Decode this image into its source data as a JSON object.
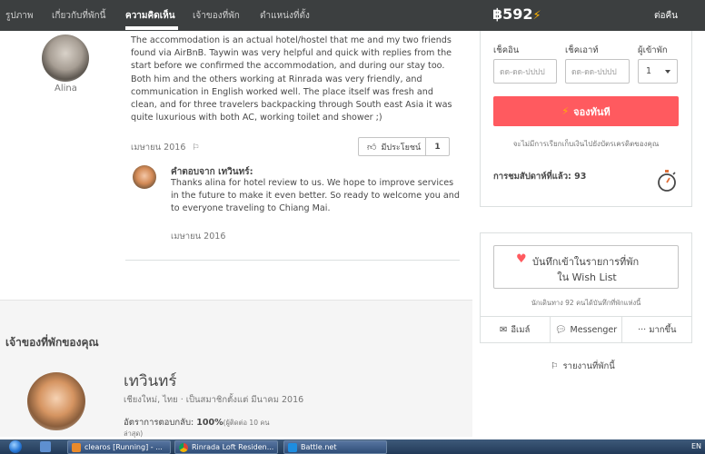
{
  "nav": {
    "tabs": [
      "รูปภาพ",
      "เกี่ยวกับที่พักนี้",
      "ความคิดเห็น",
      "เจ้าของที่พัก",
      "ตำแหน่งที่ตั้ง"
    ],
    "price": "฿592",
    "per_night": "ต่อคืน"
  },
  "review": {
    "reviewer": "Alina",
    "text": "The accommodation is an actual hotel/hostel that me and my two friends found via AirBnB. Taywin was very helpful and quick with replies from the start before we confirmed the accommodation, and during our stay too. Both him and the others working at Rinrada was very friendly, and communication in English worked well. The place itself was fresh and clean, and for three travelers backpacking through South east Asia it was quite luxurious with both AC, working toilet and shower ;)",
    "date": "เมษายน 2016",
    "helpful_label": "มีประโยชน์",
    "helpful_count": "1",
    "reply_title": "คำตอบจาก เทวินทร์:",
    "reply_text": "Thanks alina for hotel review to us. We hope to improve services in the future to make it even better. So ready to welcome you and to everyone traveling to Chiang Mai.",
    "reply_date": "เมษายน 2016"
  },
  "host": {
    "section_title": "เจ้าของที่พักของคุณ",
    "name": "เทวินทร์",
    "meta": "เชียงใหม่, ไทย · เป็นสมาชิกตั้งแต่ มีนาคม 2016",
    "rate_label": "อัตราการตอบกลับ:",
    "rate_value": "100%",
    "rate_note": "(ผู้ติดต่อ 10 คน",
    "rate_note2": "ล่าสุด)"
  },
  "booking": {
    "checkin_label": "เช็คอิน",
    "checkout_label": "เช็คเอาท์",
    "guests_label": "ผู้เข้าพัก",
    "date_placeholder": "ดด-ดด-ปปปป",
    "guests_value": "1",
    "book_button": "จองทันที",
    "no_charge_note": "จะไม่มีการเรียกเก็บเงินไปยังบัตรเครดิตของคุณ",
    "views": "การชมสัปดาห์ที่แล้ว: 93"
  },
  "wishlist": {
    "line1": "บันทึกเข้าในรายการที่พัก",
    "line2": "ใน Wish List",
    "saved_count": "นักเดินทาง 92 คนได้บันทึกที่พักแห่งนี้",
    "share": {
      "email": "อีเมล์",
      "messenger": "Messenger",
      "more": "··· มากขึ้น"
    },
    "report": "รายงานที่พักนี้"
  },
  "taskbar": {
    "task1": "clearos [Running] - ...",
    "task2": "Rinrada Loft Residen...",
    "task3": "Battle.net",
    "lang": "EN"
  },
  "colors": {
    "accent": "#ff5a5f",
    "lightning": "#ffb400",
    "nav_bg": "#3c3f40"
  }
}
